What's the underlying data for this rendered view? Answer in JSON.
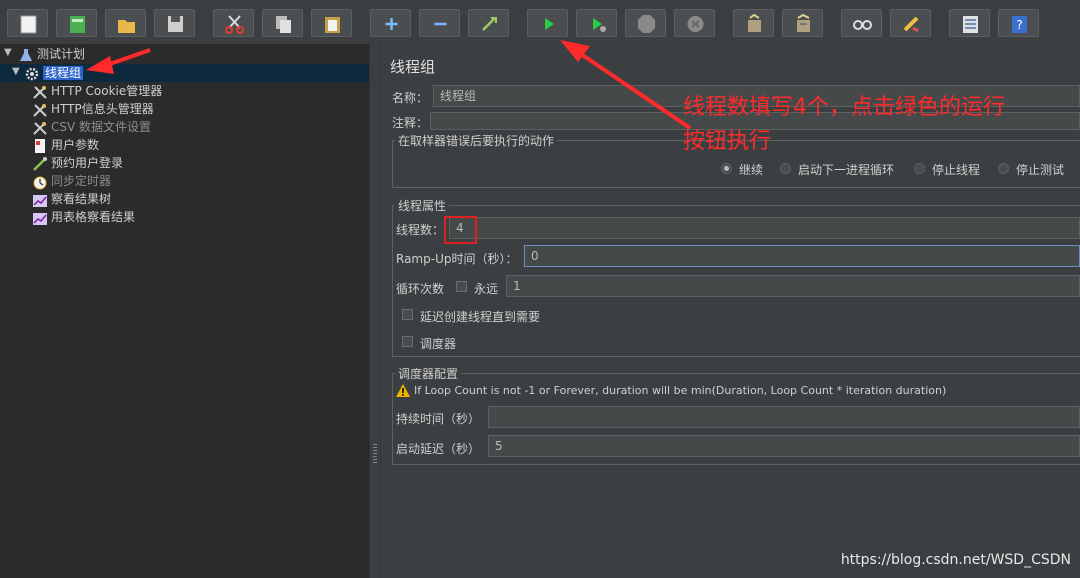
{
  "toolbar": {
    "buttons": [
      "new-icon",
      "templates-icon",
      "open-icon",
      "save-icon",
      "cut-icon",
      "copy-icon",
      "paste-icon",
      "expand-icon",
      "collapse-icon",
      "toggle-icon",
      "start-icon",
      "start-no-pause-icon",
      "stop-icon",
      "shutdown-icon",
      "clear-icon",
      "clear-all-icon",
      "search-icon",
      "reset-search-icon",
      "function-helper-icon",
      "help-icon"
    ]
  },
  "tree": {
    "root": "测试计划",
    "selected": "线程组",
    "children": [
      {
        "label": "HTTP Cookie管理器",
        "icon": "wrench-icon",
        "dim": false
      },
      {
        "label": "HTTP信息头管理器",
        "icon": "wrench-icon",
        "dim": false
      },
      {
        "label": "CSV 数据文件设置",
        "icon": "wrench-icon",
        "dim": true
      },
      {
        "label": "用户参数",
        "icon": "document-icon",
        "dim": false
      },
      {
        "label": "预约用户登录",
        "icon": "pipette-icon",
        "dim": false
      },
      {
        "label": "同步定时器",
        "icon": "timer-icon",
        "dim": true
      },
      {
        "label": "察看结果树",
        "icon": "chart-icon",
        "dim": false
      },
      {
        "label": "用表格察看结果",
        "icon": "chart-icon",
        "dim": false
      }
    ]
  },
  "panel": {
    "title": "线程组",
    "name_label": "名称：",
    "name_value": "线程组",
    "comment_label": "注释：",
    "error_group_title": "在取样器错误后要执行的动作",
    "error_options": [
      "继续",
      "启动下一进程循环",
      "停止线程",
      "停止测试"
    ],
    "error_selected": "继续",
    "props_title": "线程属性",
    "threads_label": "线程数：",
    "threads_value": "4",
    "rampup_label": "Ramp-Up时间（秒）：",
    "rampup_value": "0",
    "loop_label": "循环次数",
    "forever_label": "永远",
    "loop_value": "1",
    "delay_label": "延迟创建线程直到需要",
    "scheduler_label": "调度器",
    "sched_title": "调度器配置",
    "warning": "If Loop Count is not -1 or Forever, duration will be min(Duration, Loop Count * iteration duration)",
    "duration_label": "持续时间（秒）",
    "duration_value": "",
    "startup_label": "启动延迟（秒）",
    "startup_value": "5"
  },
  "annotation": {
    "line1": "线程数填写4个，点击绿色的运行",
    "line2": "按钮执行",
    "color": "#ff2a2a"
  },
  "watermark": "https://blog.csdn.net/WSD_CSDN"
}
